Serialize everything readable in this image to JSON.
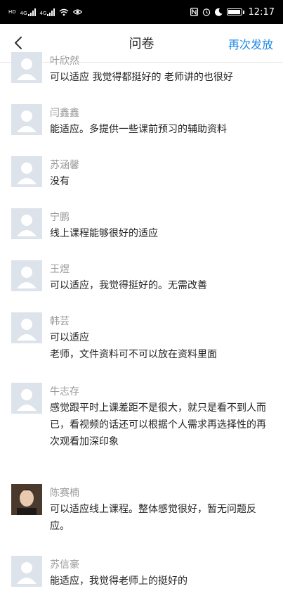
{
  "status_bar": {
    "left_labels": [
      "HD",
      "4G",
      "4G"
    ],
    "battery_percent": 95,
    "time": "12:17"
  },
  "nav": {
    "back_icon": "chevron-left-icon",
    "title": "问卷",
    "action_label": "再次发放"
  },
  "responses": [
    {
      "name": "叶欣然",
      "text": "可以适应  我觉得都挺好的  老师讲的也很好",
      "avatar": "default"
    },
    {
      "name": "闫鑫鑫",
      "text": "能适应。多提供一些课前预习的辅助资料",
      "avatar": "default"
    },
    {
      "name": "苏涵馨",
      "text": "没有",
      "avatar": "default"
    },
    {
      "name": "宁鹏",
      "text": "线上课程能够很好的适应",
      "avatar": "default"
    },
    {
      "name": "王煜",
      "text": "可以适应，我觉得挺好的。无需改善",
      "avatar": "default"
    },
    {
      "name": "韩芸",
      "text": "可以适应\n老师，文件资料可不可以放在资料里面",
      "avatar": "default"
    },
    {
      "name": "牛志存",
      "text": "感觉跟平时上课差距不是很大，就只是看不到人而已，看视频的话还可以根据个人需求再选择性的再次观看加深印象",
      "avatar": "default"
    },
    {
      "name": "陈赛楠",
      "text": "可以适应线上课程。整体感觉很好，暂无问题反应。",
      "avatar": "photo"
    },
    {
      "name": "苏信豪",
      "text": "能适应，我觉得老师上的挺好的",
      "avatar": "default"
    }
  ],
  "colors": {
    "accent": "#1e88e5",
    "name_gray": "#9a9a9a",
    "avatar_bg": "#dde3ea"
  }
}
